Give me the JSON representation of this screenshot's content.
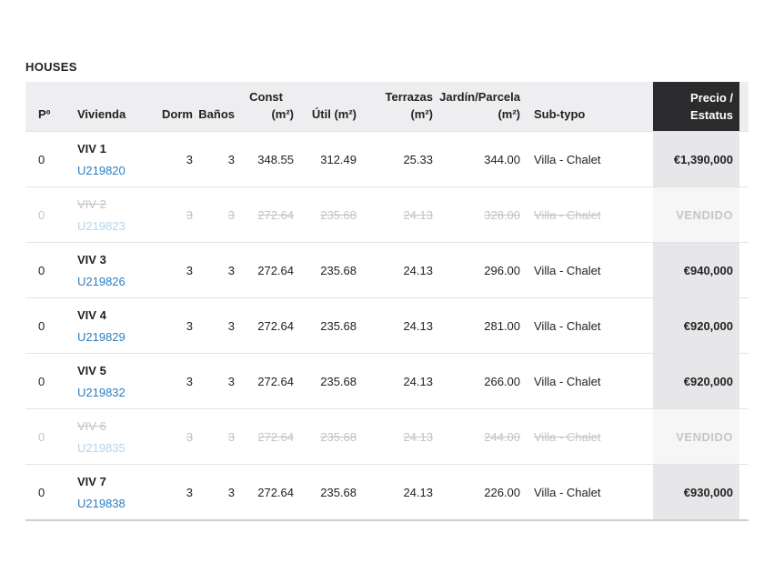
{
  "section_title": "HOUSES",
  "headers": {
    "p": "Pº",
    "vivienda": "Vivienda",
    "dorm": "Dorm",
    "banos": "Baños",
    "const_line1": "Const",
    "const_line2": "(m²)",
    "util": "Útil (m²)",
    "terrazas_line1": "Terrazas",
    "terrazas_line2": "(m²)",
    "jardin_line1": "Jardín/Parcela",
    "jardin_line2": "(m²)",
    "subtipo": "Sub-typo",
    "precio_line1": "Precio /",
    "precio_line2": "Estatus"
  },
  "rows": [
    {
      "p": "0",
      "name": "VIV 1",
      "ref": "U219820",
      "dorm": "3",
      "banos": "3",
      "const": "348.55",
      "util": "312.49",
      "terrazas": "25.33",
      "jardin": "344.00",
      "subtipo": "Villa - Chalet",
      "precio": "€1,390,000",
      "sold": false
    },
    {
      "p": "0",
      "name": "VIV 2",
      "ref": "U219823",
      "dorm": "3",
      "banos": "3",
      "const": "272.64",
      "util": "235.68",
      "terrazas": "24.13",
      "jardin": "328.00",
      "subtipo": "Villa - Chalet",
      "precio": "VENDIDO",
      "sold": true
    },
    {
      "p": "0",
      "name": "VIV 3",
      "ref": "U219826",
      "dorm": "3",
      "banos": "3",
      "const": "272.64",
      "util": "235.68",
      "terrazas": "24.13",
      "jardin": "296.00",
      "subtipo": "Villa - Chalet",
      "precio": "€940,000",
      "sold": false
    },
    {
      "p": "0",
      "name": "VIV 4",
      "ref": "U219829",
      "dorm": "3",
      "banos": "3",
      "const": "272.64",
      "util": "235.68",
      "terrazas": "24.13",
      "jardin": "281.00",
      "subtipo": "Villa - Chalet",
      "precio": "€920,000",
      "sold": false
    },
    {
      "p": "0",
      "name": "VIV 5",
      "ref": "U219832",
      "dorm": "3",
      "banos": "3",
      "const": "272.64",
      "util": "235.68",
      "terrazas": "24.13",
      "jardin": "266.00",
      "subtipo": "Villa - Chalet",
      "precio": "€920,000",
      "sold": false
    },
    {
      "p": "0",
      "name": "VIV 6",
      "ref": "U219835",
      "dorm": "3",
      "banos": "3",
      "const": "272.64",
      "util": "235.68",
      "terrazas": "24.13",
      "jardin": "244.00",
      "subtipo": "Villa - Chalet",
      "precio": "VENDIDO",
      "sold": true
    },
    {
      "p": "0",
      "name": "VIV 7",
      "ref": "U219838",
      "dorm": "3",
      "banos": "3",
      "const": "272.64",
      "util": "235.68",
      "terrazas": "24.13",
      "jardin": "226.00",
      "subtipo": "Villa - Chalet",
      "precio": "€930,000",
      "sold": false
    }
  ],
  "colors": {
    "header_bg": "#eeeef0",
    "price_header_bg": "#2b2b2d",
    "price_cell_bg": "#e7e7ea",
    "link": "#2d7fc1",
    "sold_text": "#c4c4c6"
  }
}
